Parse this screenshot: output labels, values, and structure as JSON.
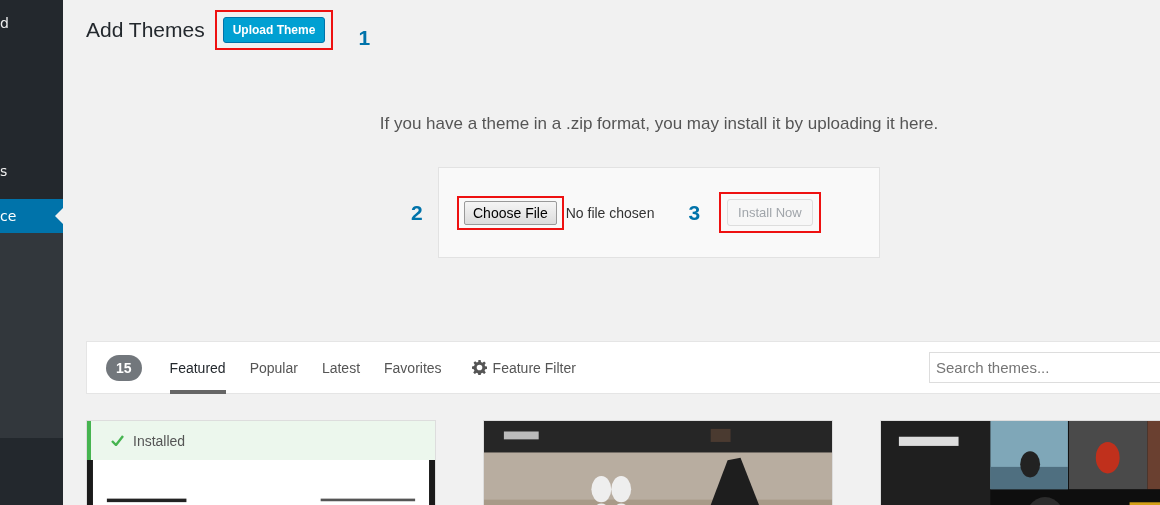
{
  "sidebar": {
    "items": [
      {
        "label": "d",
        "selected": false
      },
      {
        "label": "s",
        "selected": false
      },
      {
        "label": "ce",
        "selected": true
      }
    ]
  },
  "header": {
    "title": "Add Themes",
    "upload_button": "Upload Theme",
    "step": "1"
  },
  "upload": {
    "instructions": "If you have a theme in a .zip format, you may install it by uploading it here.",
    "choose_step": "2",
    "choose_file": "Choose File",
    "file_status": "No file chosen",
    "install_step": "3",
    "install_button": {
      "label": "Install Now",
      "disabled": true
    }
  },
  "filter_bar": {
    "count": "15",
    "tabs": [
      {
        "label": "Featured",
        "selected": true
      },
      {
        "label": "Popular",
        "selected": false
      },
      {
        "label": "Latest",
        "selected": false
      },
      {
        "label": "Favorites",
        "selected": false
      }
    ],
    "feature_filter": "Feature Filter",
    "search": {
      "placeholder": "Search themes..."
    }
  },
  "themes": [
    {
      "kind": "picture",
      "installed": true,
      "status": "Installed"
    },
    {
      "kind": "picture",
      "installed": false
    },
    {
      "kind": "picture",
      "installed": false
    }
  ]
}
